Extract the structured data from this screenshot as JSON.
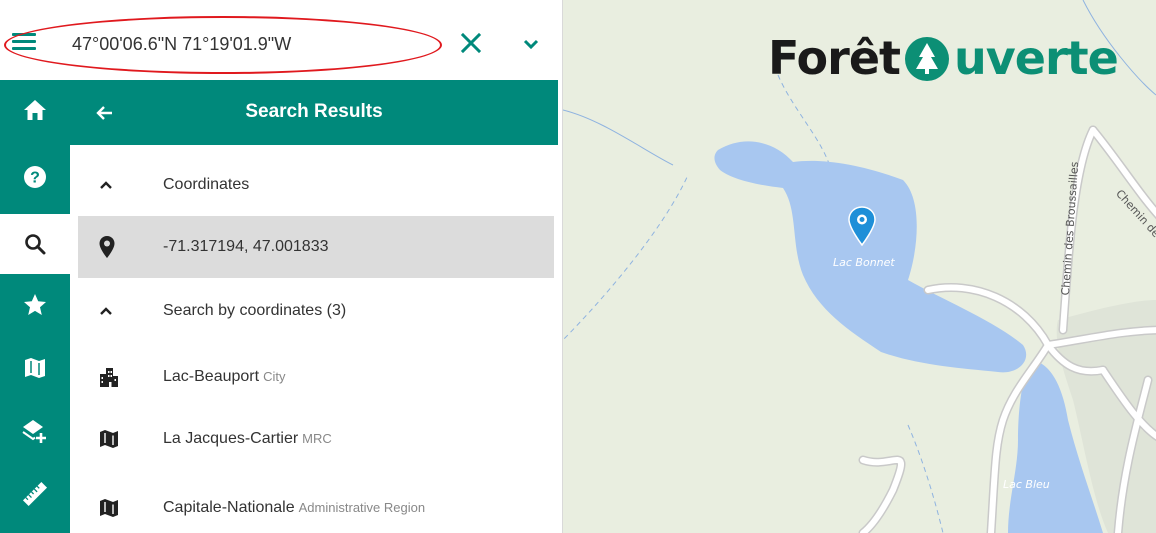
{
  "search": {
    "value": "47°00'06.6\"N 71°19'01.9\"W"
  },
  "colors": {
    "accent": "#00897b",
    "highlight_oval": "#e0191e",
    "water": "#a8c7f0",
    "map_bg": "#e9eee0",
    "pin": "#1e8fd8"
  },
  "rail": {
    "items": [
      {
        "icon": "home-icon"
      },
      {
        "icon": "help-icon"
      },
      {
        "icon": "search-icon",
        "active": true
      },
      {
        "icon": "star-icon"
      },
      {
        "icon": "map-icon"
      },
      {
        "icon": "add-layer-icon"
      },
      {
        "icon": "ruler-icon"
      }
    ]
  },
  "results": {
    "title": "Search Results",
    "groups": [
      {
        "label": "Coordinates",
        "icon": "chevron-up-icon"
      },
      {
        "label": "Search by coordinates (3)",
        "icon": "chevron-up-icon"
      }
    ],
    "coordinate_result": {
      "label": "-71.317194, 47.001833",
      "icon": "location-pin-icon"
    },
    "places": [
      {
        "name": "Lac-Beauport",
        "type": "City",
        "icon": "city-icon"
      },
      {
        "name": "La Jacques-Cartier",
        "type": "MRC",
        "icon": "map-icon"
      },
      {
        "name": "Capitale-Nationale",
        "type": "Administrative Region",
        "icon": "map-icon"
      }
    ]
  },
  "map": {
    "logo_left": "Forêt",
    "logo_right": "uverte",
    "labels": {
      "lac_bonnet": "Lac Bonnet",
      "lac_bleu": "Lac Bleu",
      "road_broussailles": "Chemin des Broussailles",
      "road_partial": "Chemin de"
    }
  }
}
